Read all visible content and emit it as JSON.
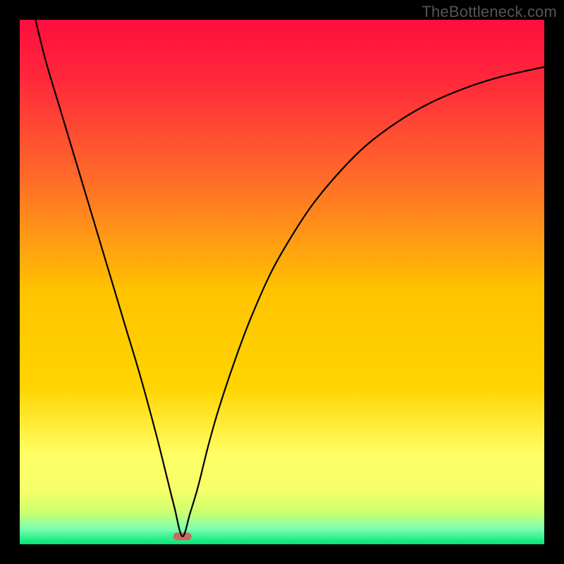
{
  "watermark": "TheBottleneck.com",
  "chart_data": {
    "type": "line",
    "title": "",
    "xlabel": "",
    "ylabel": "",
    "xlim": [
      0,
      100
    ],
    "ylim": [
      0,
      100
    ],
    "background_gradient": {
      "top": "#ff0d3e",
      "mid_upper": "#ff6a2a",
      "mid": "#ffd400",
      "lower": "#ffff66",
      "near_bottom": "#caff70",
      "bottom": "#00e676"
    },
    "marker": {
      "x": 31,
      "y": 1.5,
      "color": "#c86a63"
    },
    "series": [
      {
        "name": "curve",
        "style": "black-line",
        "x": [
          3,
          5,
          8,
          11,
          14,
          17,
          20,
          23,
          26,
          28,
          29.5,
          31,
          32.5,
          34,
          36,
          38,
          41,
          44,
          48,
          52,
          56,
          61,
          66,
          72,
          78,
          85,
          92,
          100
        ],
        "y": [
          100,
          92,
          82,
          72,
          62,
          52,
          42,
          32,
          21,
          13,
          7,
          1.5,
          6,
          11,
          19,
          26,
          35,
          43,
          52,
          59,
          65,
          71,
          76,
          80.5,
          84,
          87,
          89.2,
          91
        ]
      }
    ]
  }
}
